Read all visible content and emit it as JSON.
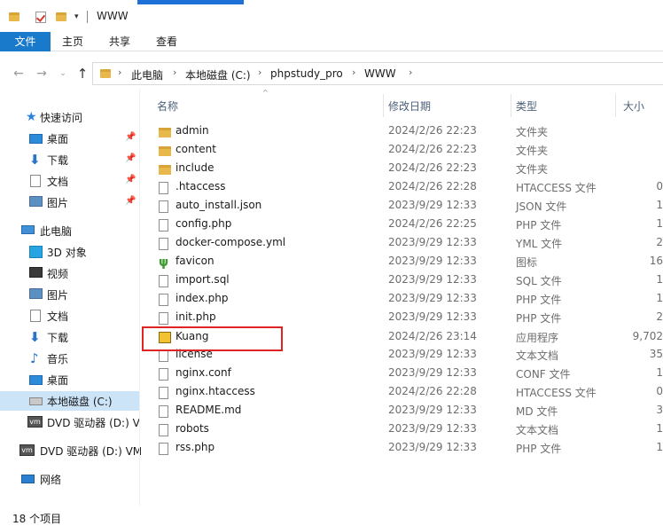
{
  "window": {
    "title": "WWW"
  },
  "ribbon": {
    "tabs": [
      "文件",
      "主页",
      "共享",
      "查看"
    ]
  },
  "address": {
    "crumbs": [
      "此电脑",
      "本地磁盘 (C:)",
      "phpstudy_pro",
      "WWW"
    ]
  },
  "sidebar": {
    "items": [
      {
        "label": "快速访问",
        "icon": "star-icon"
      },
      {
        "label": "桌面",
        "icon": "desktop-icon",
        "pinned": true
      },
      {
        "label": "下载",
        "icon": "download-icon",
        "pinned": true
      },
      {
        "label": "文档",
        "icon": "document-icon",
        "pinned": true
      },
      {
        "label": "图片",
        "icon": "picture-icon",
        "pinned": true
      },
      {
        "label": "此电脑",
        "icon": "computer-icon"
      },
      {
        "label": "3D 对象",
        "icon": "3d-objects-icon"
      },
      {
        "label": "视频",
        "icon": "video-icon"
      },
      {
        "label": "图片",
        "icon": "picture-icon"
      },
      {
        "label": "文档",
        "icon": "document-icon"
      },
      {
        "label": "下载",
        "icon": "download-icon"
      },
      {
        "label": "音乐",
        "icon": "music-icon"
      },
      {
        "label": "桌面",
        "icon": "desktop-icon"
      },
      {
        "label": "本地磁盘 (C:)",
        "icon": "drive-icon",
        "selected": true
      },
      {
        "label": "DVD 驱动器 (D:) V",
        "icon": "dvd-icon"
      },
      {
        "label": "DVD 驱动器 (D:) VM",
        "icon": "dvd-icon"
      },
      {
        "label": "网络",
        "icon": "network-icon"
      }
    ]
  },
  "columns": {
    "name": "名称",
    "date": "修改日期",
    "type": "类型",
    "size": "大小"
  },
  "files": [
    {
      "name": "admin",
      "date": "2024/2/26 22:23",
      "type": "文件夹",
      "size": "",
      "kind": "folder"
    },
    {
      "name": "content",
      "date": "2024/2/26 22:23",
      "type": "文件夹",
      "size": "",
      "kind": "folder"
    },
    {
      "name": "include",
      "date": "2024/2/26 22:23",
      "type": "文件夹",
      "size": "",
      "kind": "folder"
    },
    {
      "name": ".htaccess",
      "date": "2024/2/26 22:28",
      "type": "HTACCESS 文件",
      "size": "0",
      "kind": "file"
    },
    {
      "name": "auto_install.json",
      "date": "2023/9/29 12:33",
      "type": "JSON 文件",
      "size": "1",
      "kind": "file"
    },
    {
      "name": "config.php",
      "date": "2024/2/26 22:25",
      "type": "PHP 文件",
      "size": "1",
      "kind": "file"
    },
    {
      "name": "docker-compose.yml",
      "date": "2023/9/29 12:33",
      "type": "YML 文件",
      "size": "2",
      "kind": "file"
    },
    {
      "name": "favicon",
      "date": "2023/9/29 12:33",
      "type": "图标",
      "size": "16",
      "kind": "icon"
    },
    {
      "name": "import.sql",
      "date": "2023/9/29 12:33",
      "type": "SQL 文件",
      "size": "1",
      "kind": "file"
    },
    {
      "name": "index.php",
      "date": "2023/9/29 12:33",
      "type": "PHP 文件",
      "size": "1",
      "kind": "file"
    },
    {
      "name": "init.php",
      "date": "2023/9/29 12:33",
      "type": "PHP 文件",
      "size": "2",
      "kind": "file"
    },
    {
      "name": "Kuang",
      "date": "2024/2/26 23:14",
      "type": "应用程序",
      "size": "9,702",
      "kind": "app"
    },
    {
      "name": "license",
      "date": "2023/9/29 12:33",
      "type": "文本文档",
      "size": "35",
      "kind": "file"
    },
    {
      "name": "nginx.conf",
      "date": "2023/9/29 12:33",
      "type": "CONF 文件",
      "size": "1",
      "kind": "file"
    },
    {
      "name": "nginx.htaccess",
      "date": "2024/2/26 22:28",
      "type": "HTACCESS 文件",
      "size": "0",
      "kind": "file"
    },
    {
      "name": "README.md",
      "date": "2023/9/29 12:33",
      "type": "MD 文件",
      "size": "3",
      "kind": "file"
    },
    {
      "name": "robots",
      "date": "2023/9/29 12:33",
      "type": "文本文档",
      "size": "1",
      "kind": "file"
    },
    {
      "name": "rss.php",
      "date": "2023/9/29 12:33",
      "type": "PHP 文件",
      "size": "1",
      "kind": "file"
    }
  ],
  "status": {
    "count": "18 个项目"
  },
  "colors": {
    "accent": "#1979ca",
    "selection": "#cce4f7",
    "highlight": "#e02424"
  }
}
